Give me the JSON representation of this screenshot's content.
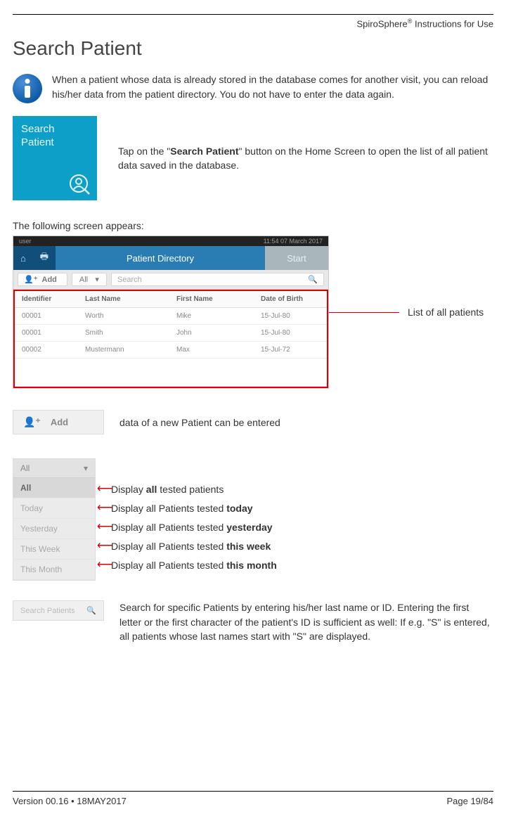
{
  "header": {
    "product": "SpiroSphere",
    "suffix": " Instructions for Use"
  },
  "title": "Search Patient",
  "intro_note": "When a patient whose data is already stored in the database comes for another visit, you can reload his/her data from the patient directory. You do not have to enter the data again.",
  "tile": {
    "line1": "Search",
    "line2": "Patient",
    "desc_pre": "Tap on the \"",
    "desc_bold": "Search Patient",
    "desc_post": "\" button on the Home Screen to open the list of all patient data saved in the database."
  },
  "following_text": "The following screen appears:",
  "screenshot": {
    "top_left": "user",
    "top_right": "11:54 07 March 2017",
    "title": "Patient Directory",
    "start": "Start",
    "toolbar": {
      "add": "Add",
      "filter": "All",
      "search": "Search"
    },
    "columns": {
      "id": "Identifier",
      "ln": "Last Name",
      "fn": "First Name",
      "dob": "Date of Birth"
    },
    "rows": [
      {
        "id": "00001",
        "ln": "Worth",
        "fn": "Mike",
        "dob": "15-Jul-80"
      },
      {
        "id": "00001",
        "ln": "Smith",
        "fn": "John",
        "dob": "15-Jul-80"
      },
      {
        "id": "00002",
        "ln": "Mustermann",
        "fn": "Max",
        "dob": "15-Jul-72"
      }
    ]
  },
  "callout_list": "List of all patients",
  "add": {
    "label": "Add",
    "desc": "data of a new Patient can be entered"
  },
  "filter": {
    "head": "All",
    "items": [
      "All",
      "Today",
      "Yesterday",
      "This Week",
      "This Month"
    ],
    "labels": {
      "all_pre": "Display ",
      "all_bold": "all",
      "all_post": " tested patients",
      "today_pre": "Display all Patients tested ",
      "today_bold": "today",
      "yest_pre": "Display all Patients tested ",
      "yest_bold": "yesterday",
      "week_pre": "Display all Patients tested ",
      "week_bold": "this week",
      "month_pre": "Display all Patients tested ",
      "month_bold": "this month"
    }
  },
  "search": {
    "placeholder": "Search Patients",
    "desc": "Search for specific Patients by entering his/her last name or ID.  Entering the first letter or the first character of the patient's ID is sufficient as well: If e.g. \"S\" is entered, all patients whose last names start with \"S\" are displayed."
  },
  "footer": {
    "left": "Version 00.16 • 18MAY2017",
    "right": "Page 19/84"
  }
}
